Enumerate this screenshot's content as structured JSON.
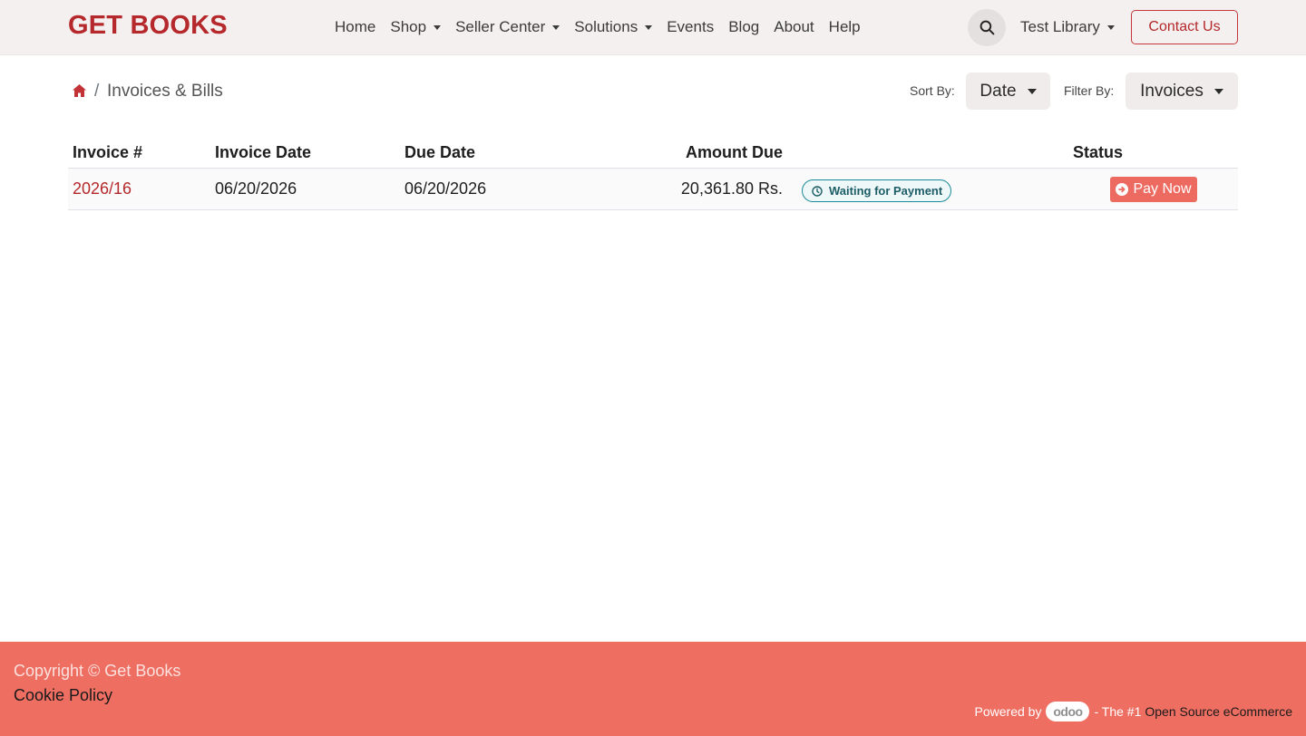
{
  "header": {
    "brand": "GET BOOKS",
    "nav": [
      {
        "label": "Home",
        "dropdown": false
      },
      {
        "label": "Shop",
        "dropdown": true
      },
      {
        "label": "Seller Center",
        "dropdown": true
      },
      {
        "label": "Solutions",
        "dropdown": true
      },
      {
        "label": "Events",
        "dropdown": false
      },
      {
        "label": "Blog",
        "dropdown": false
      },
      {
        "label": "About",
        "dropdown": false
      },
      {
        "label": "Help",
        "dropdown": false
      }
    ],
    "user_menu": "Test Library",
    "contact_label": "Contact Us",
    "icons": {
      "search": "search-icon",
      "home": "home-icon"
    }
  },
  "breadcrumb": {
    "separator": "/",
    "current": "Invoices & Bills"
  },
  "controls": {
    "sort_label": "Sort By:",
    "sort_value": "Date",
    "filter_label": "Filter By:",
    "filter_value": "Invoices"
  },
  "table": {
    "headers": {
      "invoice": "Invoice #",
      "invoice_date": "Invoice Date",
      "due_date": "Due Date",
      "amount": "Amount Due",
      "status": "Status"
    },
    "rows": [
      {
        "invoice": "2026/16",
        "invoice_date": "06/20/2026",
        "due_date": "06/20/2026",
        "amount": "20,361.80 Rs.",
        "badge": "Waiting for Payment",
        "action": "Pay Now"
      }
    ]
  },
  "footer": {
    "copyright": "Copyright © Get Books",
    "cookie": "Cookie Policy",
    "powered_by": "Powered by",
    "odoo": "odoo",
    "the_one": "- The #1",
    "oss": "Open Source eCommerce"
  },
  "colors": {
    "brand": "#b5282b",
    "header_bg": "#f4f0ef",
    "footer_bg": "#ee6e62",
    "pay_button": "#ed6a61",
    "badge_border": "#1b8a98"
  }
}
